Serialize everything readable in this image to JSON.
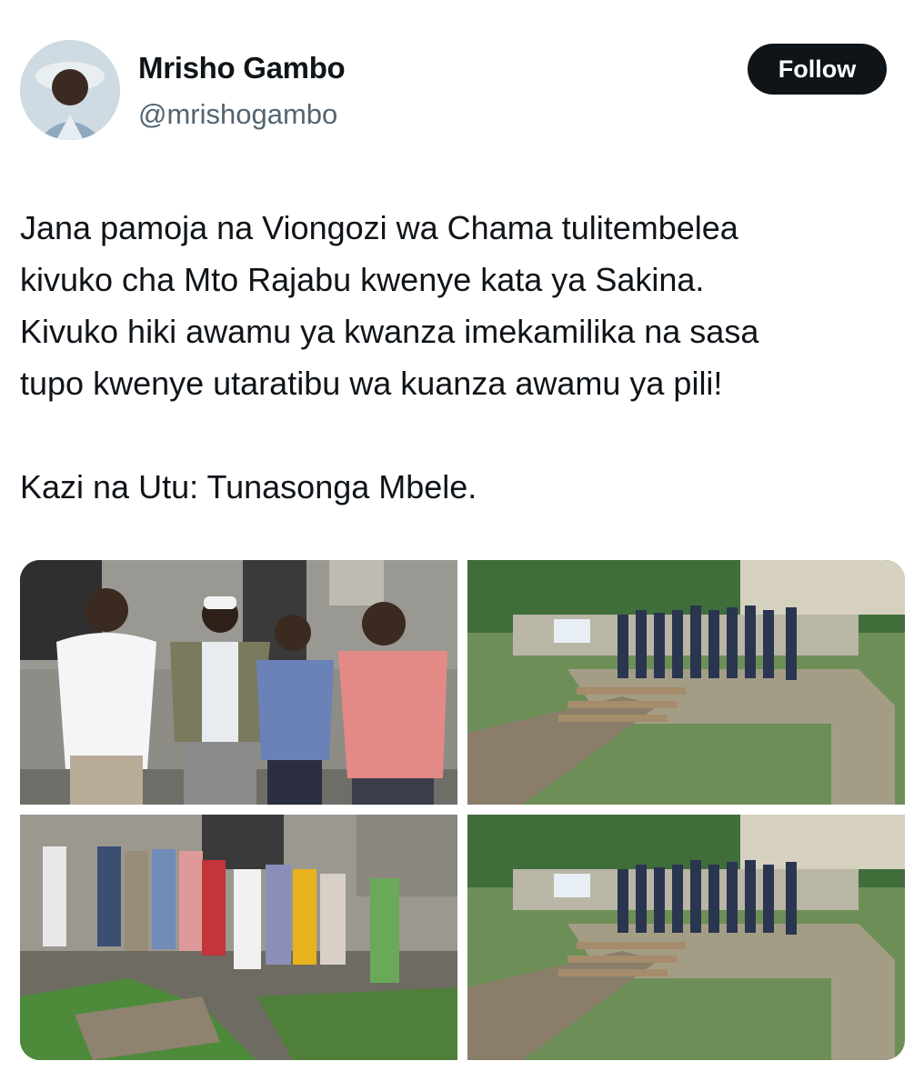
{
  "author": {
    "name": "Mrisho Gambo",
    "handle": "@mrishogambo",
    "avatar_icon": "profile-photo"
  },
  "follow_button": {
    "label": "Follow"
  },
  "tweet": {
    "lines": [
      "Jana pamoja na Viongozi wa Chama tulitembelea",
      "kivuko cha Mto Rajabu kwenye kata ya Sakina.",
      "Kivuko hiki awamu ya kwanza imekamilika na sasa",
      "tupo kwenye utaratibu wa kuanza awamu ya pili!",
      "Kazi na Utu: Tunasonga Mbele."
    ]
  },
  "media": {
    "photos": [
      {
        "name": "photo-leaders-group-chat"
      },
      {
        "name": "photo-bridge-group"
      },
      {
        "name": "photo-community-group"
      },
      {
        "name": "photo-bridge-group-repeat"
      }
    ]
  },
  "colors": {
    "text": "#0f1419",
    "secondary": "#536471",
    "follow_bg": "#0f1419",
    "follow_text": "#ffffff"
  }
}
